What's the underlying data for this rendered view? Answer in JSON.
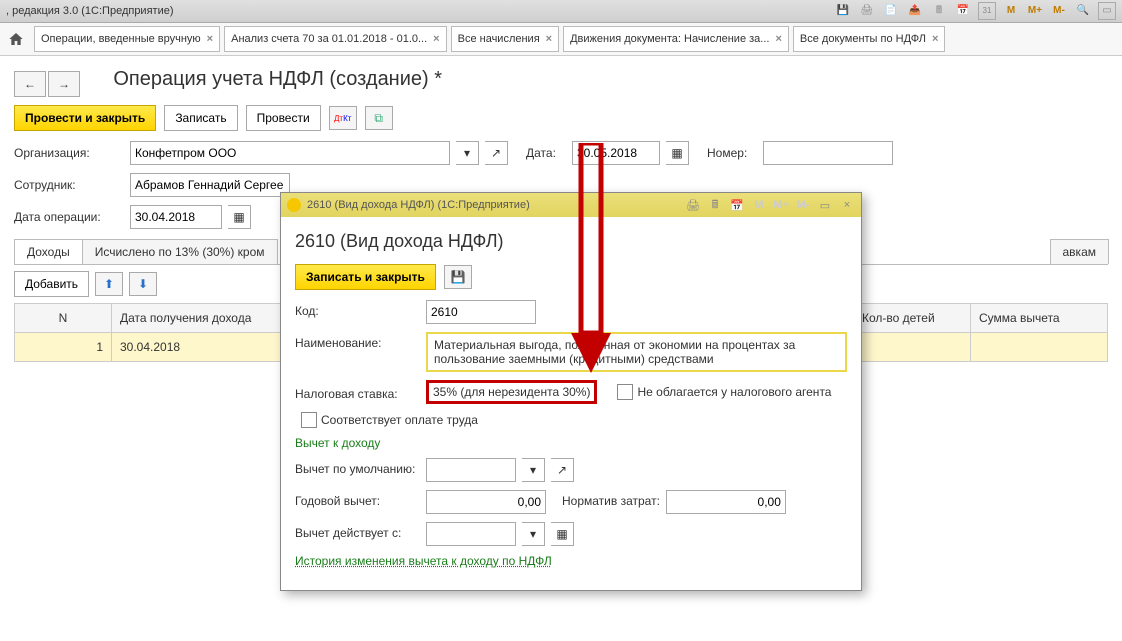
{
  "title_bar": {
    "app_title": ", редакция 3.0  (1С:Предприятие)",
    "m": "M",
    "mp": "M+",
    "mm": "M-"
  },
  "tabs": {
    "t0": "Операции, введенные вручную",
    "t1": "Анализ счета 70 за 01.01.2018 - 01.0...",
    "t2": "Все начисления",
    "t3": "Движения документа: Начисление за...",
    "t4": "Все документы по НДФЛ"
  },
  "page": {
    "title": "Операция учета НДФЛ (создание) *",
    "proceed_close": "Провести и закрыть",
    "save": "Записать",
    "proceed": "Провести"
  },
  "form": {
    "org_label": "Организация:",
    "org_value": "Конфетпром ООО",
    "date_label": "Дата:",
    "date_value": "30.05.2018",
    "number_label": "Номер:",
    "emp_label": "Сотрудник:",
    "emp_value": "Абрамов Геннадий Сергее",
    "opdate_label": "Дата операции:",
    "opdate_value": "30.04.2018"
  },
  "subtabs": {
    "st0": "Доходы",
    "st1": "Исчислено по 13% (30%) кром",
    "st_last": "авкам"
  },
  "grid": {
    "add_label": "Добавить",
    "col_n": "N",
    "col_date": "Дата получения дохода",
    "col_child": "Кол-во детей",
    "col_sum": "Сумма вычета",
    "row1_n": "1",
    "row1_date": "30.04.2018"
  },
  "dialog": {
    "title": "2610 (Вид дохода НДФЛ)  (1С:Предприятие)",
    "heading": "2610 (Вид дохода НДФЛ)",
    "save_close": "Записать и закрыть",
    "code_label": "Код:",
    "code_value": "2610",
    "name_label": "Наименование:",
    "name_value": "Материальная выгода, полученная от экономии на процентах за пользование заемными (кредитными) средствами",
    "rate_label": "Налоговая ставка:",
    "rate_value": "35% (для нерезидента 30%)",
    "not_taxed": "Не облагается у налогового агента",
    "salary_corresp": "Соответствует оплате труда",
    "deduct_header": "Вычет к доходу",
    "deduct_def_label": "Вычет по умолчанию:",
    "yearly_label": "Годовой вычет:",
    "yearly_value": "0,00",
    "norm_label": "Норматив затрат:",
    "norm_value": "0,00",
    "deduct_from_label": "Вычет действует с:",
    "history_link": "История изменения вычета к доходу по НДФЛ"
  }
}
